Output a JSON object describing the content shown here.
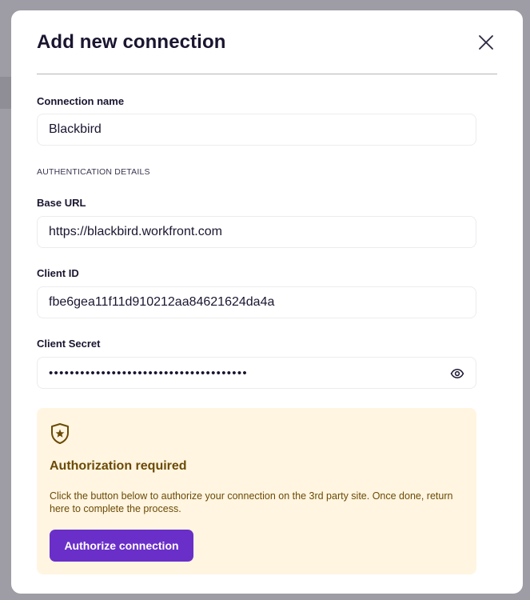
{
  "modal": {
    "title": "Add new connection"
  },
  "form": {
    "connection_name": {
      "label": "Connection name",
      "value": "Blackbird"
    },
    "section_heading": "AUTHENTICATION DETAILS",
    "base_url": {
      "label": "Base URL",
      "value": "https://blackbird.workfront.com"
    },
    "client_id": {
      "label": "Client ID",
      "value": "fbe6gea11f11d910212aa84621624da4a"
    },
    "client_secret": {
      "label": "Client Secret",
      "value": "••••••••••••••••••••••••••••••••••••••"
    }
  },
  "auth": {
    "title": "Authorization required",
    "text": "Click the button below to authorize your connection on the 3rd party site. Once done, return here to complete the process.",
    "button_label": "Authorize connection"
  },
  "icons": {
    "close": "close-icon",
    "eye": "eye-icon",
    "shield": "shield-star-icon"
  },
  "colors": {
    "accent": "#6a2fc9",
    "auth_bg": "#fff5e1",
    "auth_text": "#6b4a05",
    "title_text": "#1b1530"
  }
}
